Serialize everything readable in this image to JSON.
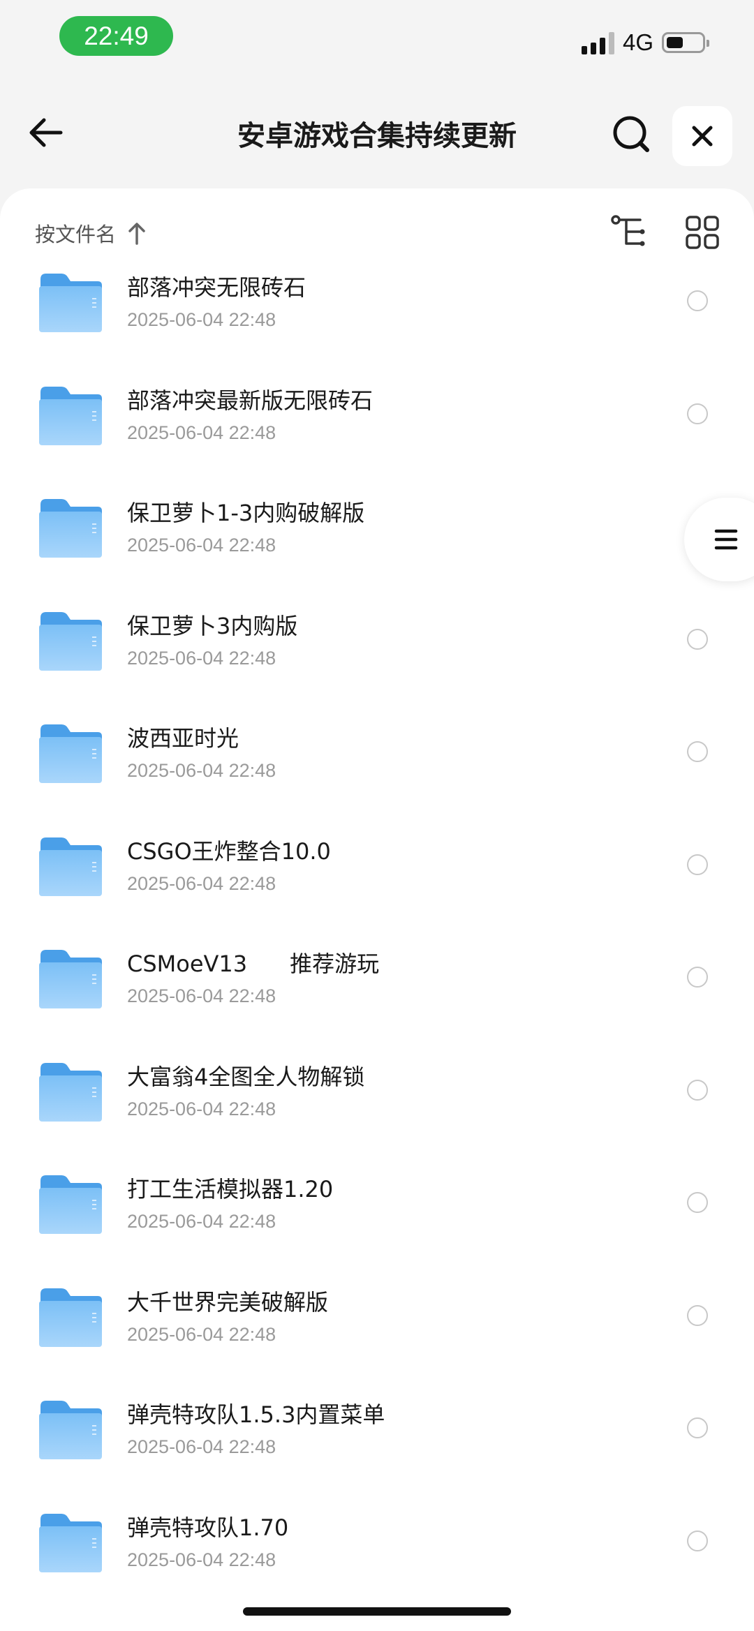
{
  "status_bar": {
    "time": "22:49",
    "network": "4G",
    "battery_level": 0.45
  },
  "header": {
    "title": "安卓游戏合集持续更新"
  },
  "toolbar": {
    "sort_label": "按文件名"
  },
  "colors": {
    "folder": "#6fb6f4",
    "status_pill": "#2eb84f"
  },
  "files": [
    {
      "name": "部落冲突无限砖石",
      "date": "2025-06-04 22:48"
    },
    {
      "name": "部落冲突最新版无限砖石",
      "date": "2025-06-04 22:48"
    },
    {
      "name": "保卫萝卜1-3内购破解版",
      "date": "2025-06-04 22:48"
    },
    {
      "name": "保卫萝卜3内购版",
      "date": "2025-06-04 22:48"
    },
    {
      "name": "波西亚时光",
      "date": "2025-06-04 22:48"
    },
    {
      "name": "CSGO王炸整合10.0",
      "date": "2025-06-04 22:48"
    },
    {
      "name": "CSMoeV13      推荐游玩",
      "date": "2025-06-04 22:48"
    },
    {
      "name": "大富翁4全图全人物解锁",
      "date": "2025-06-04 22:48"
    },
    {
      "name": "打工生活模拟器1.20",
      "date": "2025-06-04 22:48"
    },
    {
      "name": "大千世界完美破解版",
      "date": "2025-06-04 22:48"
    },
    {
      "name": "弹壳特攻队1.5.3内置菜单",
      "date": "2025-06-04 22:48"
    },
    {
      "name": "弹壳特攻队1.70",
      "date": "2025-06-04 22:48"
    }
  ]
}
